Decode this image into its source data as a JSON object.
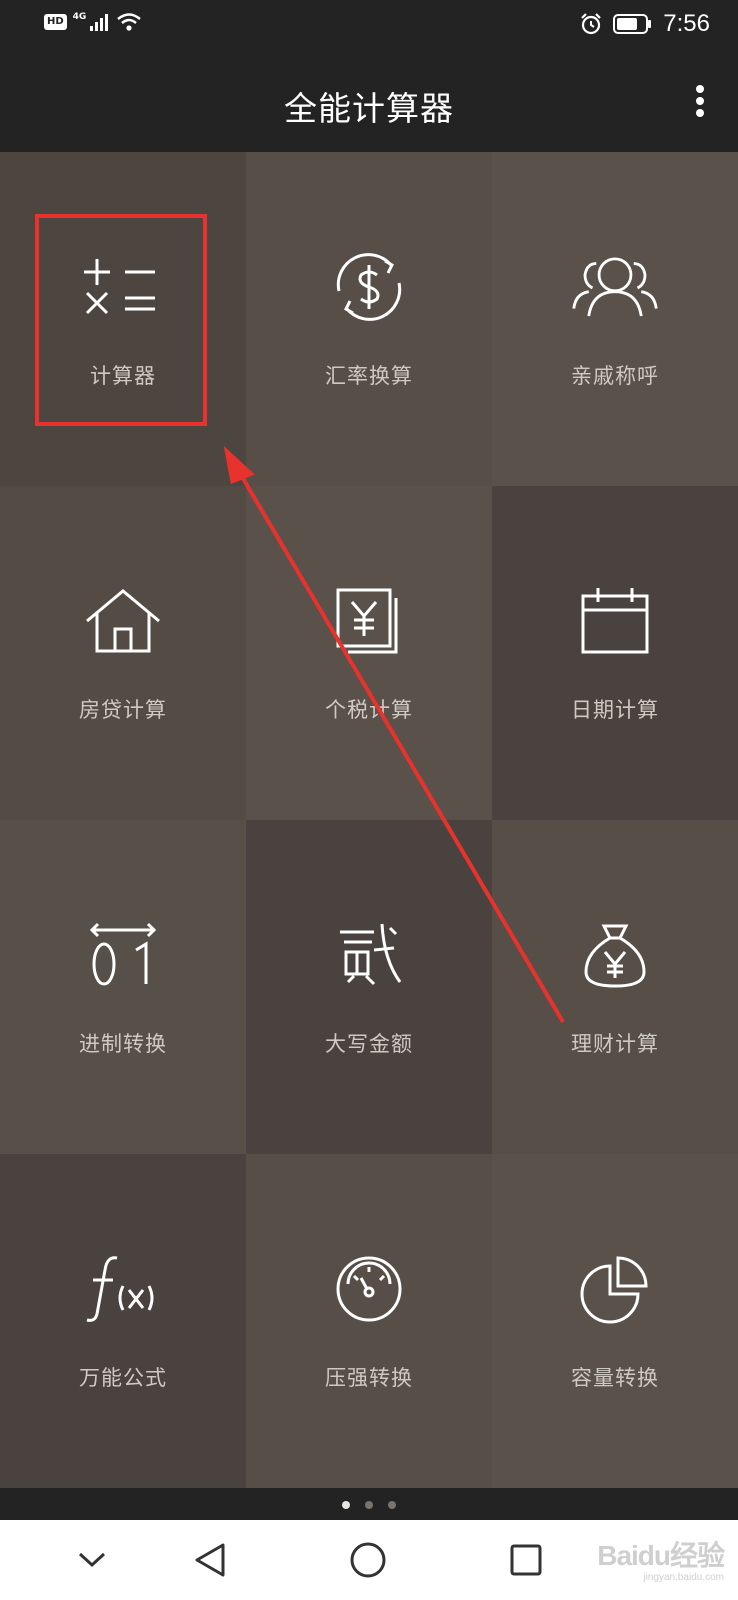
{
  "status_bar": {
    "left_badges": [
      "HD",
      "4G"
    ],
    "icons": [
      "signal-icon",
      "wifi-icon",
      "alarm-icon",
      "battery-icon"
    ],
    "time": "7:56"
  },
  "app_bar": {
    "title": "全能计算器",
    "menu_icon": "more-vert-icon"
  },
  "tiles": [
    {
      "label": "计算器",
      "icon": "calculator-icon",
      "bg": "#4d4540"
    },
    {
      "label": "汇率换算",
      "icon": "currency-exchange-icon",
      "bg": "#574e47"
    },
    {
      "label": "亲戚称呼",
      "icon": "relatives-icon",
      "bg": "#5a514a"
    },
    {
      "label": "房贷计算",
      "icon": "house-icon",
      "bg": "#544b45"
    },
    {
      "label": "个税计算",
      "icon": "tax-icon",
      "bg": "#5a514a"
    },
    {
      "label": "日期计算",
      "icon": "calendar-icon",
      "bg": "#4a423e"
    },
    {
      "label": "进制转换",
      "icon": "base-conversion-icon",
      "bg": "#575049"
    },
    {
      "label": "大写金额",
      "icon": "chinese-numeral-icon",
      "bg": "#4a423e"
    },
    {
      "label": "理财计算",
      "icon": "money-bag-icon",
      "bg": "#574e47"
    },
    {
      "label": "万能公式",
      "icon": "formula-icon",
      "bg": "#4a423e"
    },
    {
      "label": "压强转换",
      "icon": "pressure-gauge-icon",
      "bg": "#574e47"
    },
    {
      "label": "容量转换",
      "icon": "pie-chart-icon",
      "bg": "#5a514a"
    }
  ],
  "annotation": {
    "highlight_color": "#e8322d"
  },
  "page_indicator": {
    "count": 3,
    "active": 1
  },
  "watermark": {
    "brand": "Baidu经验",
    "url": "jingyan.baidu.com"
  }
}
